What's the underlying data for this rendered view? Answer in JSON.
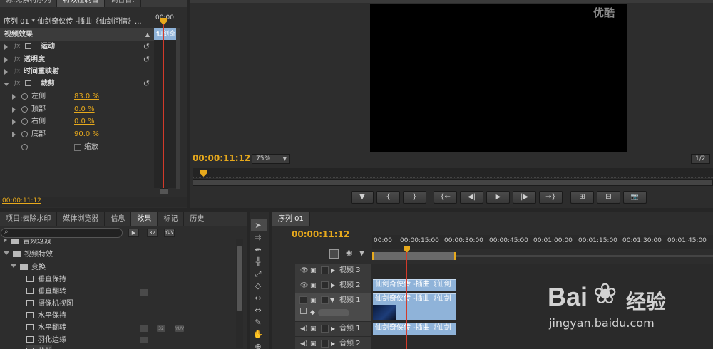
{
  "top_tabs": [
    "源:无素材序列",
    "特效控制台",
    "调音台:"
  ],
  "effect_controls": {
    "clip_title": "序列 01 * 仙剑奇侠传 -插曲《仙剑问情》...",
    "ruler_time": "00:00",
    "mini_clip": "仙剑奇",
    "header": "视频效果",
    "motion": "运动",
    "opacity": "透明度",
    "time_remap": "时间重映射",
    "crop": "裁剪",
    "params": [
      {
        "label": "左侧",
        "value": "83.0 %"
      },
      {
        "label": "顶部",
        "value": "0.0 %"
      },
      {
        "label": "右侧",
        "value": "0.0 %"
      },
      {
        "label": "底部",
        "value": "90.0 %"
      }
    ],
    "zoom_label": "缩放",
    "timecode": "00:00:11:12"
  },
  "program": {
    "watermark": "优酷",
    "timecode": "00:00:11:12",
    "zoom": "75%",
    "fraction": "1/2"
  },
  "transport_buttons": [
    "▼",
    "{",
    "}",
    "{←",
    "◀|",
    "▶",
    "|▶",
    "→}",
    "⊞",
    "⊟",
    "📷"
  ],
  "project_panel": {
    "tabs": [
      "项目:去除水印",
      "媒体浏览器",
      "信息",
      "效果",
      "标记",
      "历史"
    ],
    "search_placeholder": "",
    "badges": [
      "32",
      "YUV"
    ],
    "tree": [
      {
        "label": "音频过渡",
        "level": 0,
        "type": "folder"
      },
      {
        "label": "视频特效",
        "level": 0,
        "type": "folder"
      },
      {
        "label": "变换",
        "level": 1,
        "type": "folder"
      },
      {
        "label": "垂直保持",
        "level": 2,
        "type": "effect"
      },
      {
        "label": "垂直翻转",
        "level": 2,
        "type": "effect"
      },
      {
        "label": "摄像机视图",
        "level": 2,
        "type": "effect"
      },
      {
        "label": "水平保持",
        "level": 2,
        "type": "effect"
      },
      {
        "label": "水平翻转",
        "level": 2,
        "type": "effect"
      },
      {
        "label": "羽化边缘",
        "level": 2,
        "type": "effect"
      },
      {
        "label": "裁剪",
        "level": 2,
        "type": "effect"
      }
    ]
  },
  "timeline": {
    "tab": "序列 01",
    "timecode": "00:00:11:12",
    "ruler": [
      "00:00",
      "00:00:15:00",
      "00:00:30:00",
      "00:00:45:00",
      "00:01:00:00",
      "00:01:15:00",
      "00:01:30:00",
      "00:01:45:00"
    ],
    "tracks": [
      {
        "name": "视频 3"
      },
      {
        "name": "视频 2"
      },
      {
        "name": "视频 1"
      },
      {
        "name": "音频 1"
      },
      {
        "name": "音频 2"
      }
    ],
    "clip_label": "仙剑奇侠传 -插曲《仙剑"
  },
  "overlay_watermark": {
    "brand": "Bai",
    "brand2": "经验",
    "url": "jingyan.baidu.com"
  },
  "colors": {
    "accent": "#e7a91c",
    "clip": "#8fb3d9",
    "playhead": "#d23a2a"
  }
}
